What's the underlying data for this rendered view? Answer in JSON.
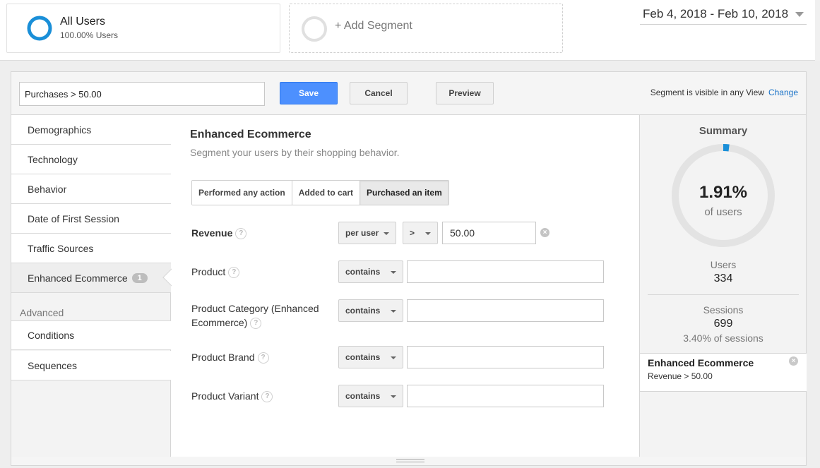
{
  "segments": {
    "current": {
      "name": "All Users",
      "percent": "100.00% Users"
    },
    "add_label": "+ Add Segment"
  },
  "date_range": "Feb 4, 2018 - Feb 10, 2018",
  "toolbar": {
    "segment_name_value": "Purchases > 50.00",
    "save_label": "Save",
    "cancel_label": "Cancel",
    "preview_label": "Preview",
    "visibility_text": "Segment is visible in any View",
    "change_label": "Change"
  },
  "nav": {
    "items": [
      {
        "label": "Demographics"
      },
      {
        "label": "Technology"
      },
      {
        "label": "Behavior"
      },
      {
        "label": "Date of First Session"
      },
      {
        "label": "Traffic Sources"
      },
      {
        "label": "Enhanced Ecommerce",
        "badge": "1"
      }
    ],
    "advanced_label": "Advanced",
    "advanced_items": [
      {
        "label": "Conditions"
      },
      {
        "label": "Sequences"
      }
    ]
  },
  "main": {
    "title": "Enhanced Ecommerce",
    "subtitle": "Segment your users by their shopping behavior.",
    "tabs": [
      {
        "label": "Performed any action",
        "active": false
      },
      {
        "label": "Added to cart",
        "active": false
      },
      {
        "label": "Purchased an item",
        "active": true
      }
    ],
    "fields": {
      "revenue": {
        "label": "Revenue",
        "scope": "per user",
        "operator": ">",
        "value": "50.00"
      },
      "product": {
        "label": "Product",
        "match": "contains",
        "value": ""
      },
      "product_category": {
        "label_line1": "Product Category (Enhanced",
        "label_line2": "Ecommerce)",
        "match": "contains",
        "value": ""
      },
      "product_brand": {
        "label": "Product Brand",
        "match": "contains",
        "value": ""
      },
      "product_variant": {
        "label": "Product Variant",
        "match": "contains",
        "value": ""
      }
    },
    "help_glyph": "?"
  },
  "summary": {
    "title": "Summary",
    "percent": "1.91%",
    "percent_fraction": 0.0191,
    "percent_sub": "of users",
    "users_label": "Users",
    "users_value": "334",
    "sessions_label": "Sessions",
    "sessions_value": "699",
    "sessions_pct": "3.40% of sessions",
    "condition": {
      "title": "Enhanced Ecommerce",
      "detail": "Revenue > 50.00"
    }
  },
  "colors": {
    "accent": "#4d90fe",
    "ring_blue": "#1a8fd8",
    "link": "#1a73c8"
  }
}
